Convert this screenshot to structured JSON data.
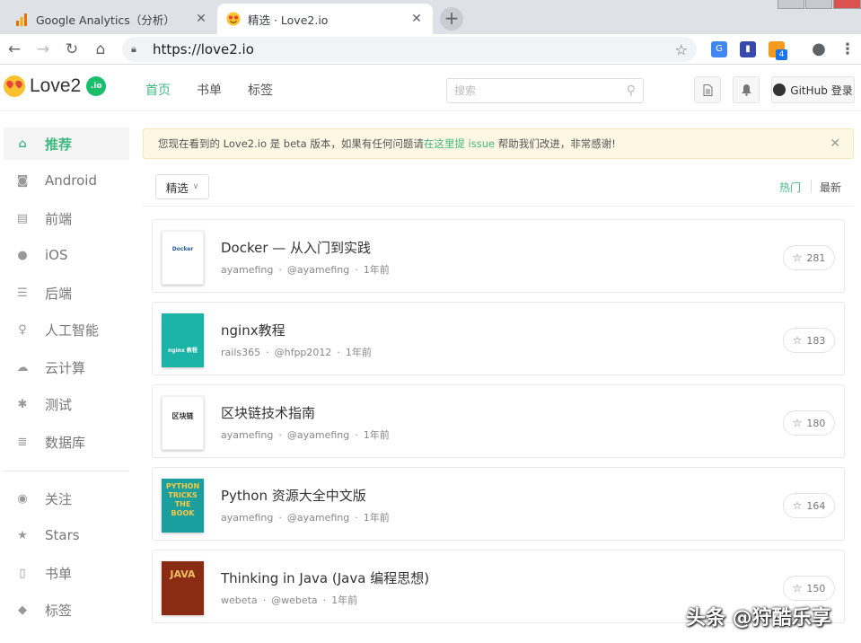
{
  "browser": {
    "tabs": [
      {
        "title": "Google Analytics（分析）",
        "favicon": "analytics-icon",
        "active": false
      },
      {
        "title": "精选 · Love2.io",
        "favicon": "love2-favicon",
        "active": true
      }
    ],
    "url": "https://love2.io",
    "extension_badge": "4"
  },
  "site": {
    "logo_text": "Love2",
    "logo_badge": ".io",
    "nav": [
      "首页",
      "书单",
      "标签"
    ],
    "search_placeholder": "搜索",
    "github_login": "GitHub 登录",
    "accent_color": "#42b983"
  },
  "sidebar": {
    "items": [
      {
        "label": "推荐",
        "icon": "home-icon",
        "active": true
      },
      {
        "label": "Android",
        "icon": "android-icon"
      },
      {
        "label": "前端",
        "icon": "html5-icon"
      },
      {
        "label": "iOS",
        "icon": "apple-icon"
      },
      {
        "label": "后端",
        "icon": "server-icon"
      },
      {
        "label": "人工智能",
        "icon": "lightbulb-icon"
      },
      {
        "label": "云计算",
        "icon": "cloud-icon"
      },
      {
        "label": "测试",
        "icon": "bug-icon"
      },
      {
        "label": "数据库",
        "icon": "database-icon"
      }
    ],
    "secondary": [
      {
        "label": "关注",
        "icon": "eye-icon"
      },
      {
        "label": "Stars",
        "icon": "star-icon"
      },
      {
        "label": "书单",
        "icon": "book-icon"
      },
      {
        "label": "标签",
        "icon": "tag-icon"
      }
    ]
  },
  "notice": {
    "before": "您现在看到的 Love2.io 是 beta 版本，如果有任何问题请",
    "link": "在这里提 issue",
    "after": " 帮助我们改进，非常感谢!"
  },
  "filter": {
    "selected": "精选"
  },
  "sort": {
    "hot": "热门",
    "latest": "最新"
  },
  "books": [
    {
      "title": "Docker — 从入门到实践",
      "author": "ayamefing",
      "handle": "@ayamefing",
      "time": "1年前",
      "stars": "281",
      "cover_text": "Docker"
    },
    {
      "title": "nginx教程",
      "author": "rails365",
      "handle": "@hfpp2012",
      "time": "1年前",
      "stars": "183",
      "cover_text": "nginx 教程"
    },
    {
      "title": "区块链技术指南",
      "author": "ayamefing",
      "handle": "@ayamefing",
      "time": "1年前",
      "stars": "180",
      "cover_text": "区块链"
    },
    {
      "title": "Python 资源大全中文版",
      "author": "ayamefing",
      "handle": "@ayamefing",
      "time": "1年前",
      "stars": "164",
      "cover_text": "PYTHON TRICKS THE BOOK"
    },
    {
      "title": "Thinking in Java (Java 编程思想)",
      "author": "webeta",
      "handle": "@webeta",
      "time": "1年前",
      "stars": "150",
      "cover_text": "JAVA"
    }
  ],
  "watermark": "头条 @狩酷乐享"
}
